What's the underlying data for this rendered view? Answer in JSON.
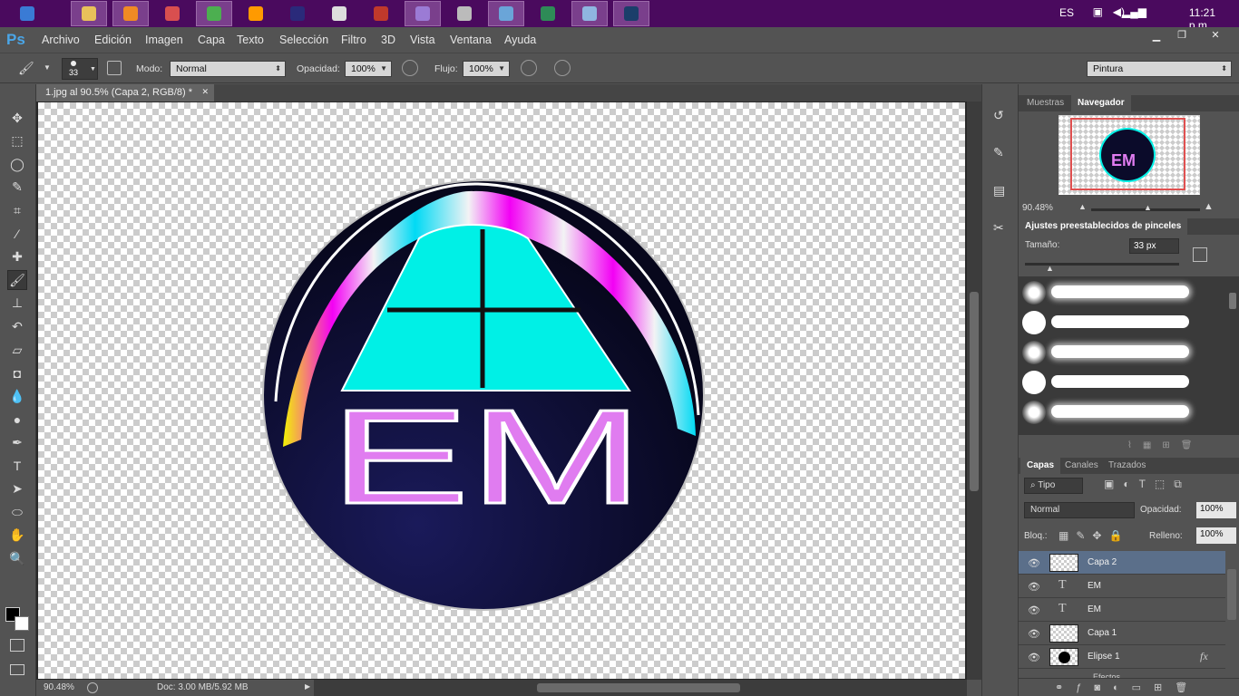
{
  "taskbar": {
    "apps": [
      {
        "icon": "start-windows-icon",
        "color": "#3a7bd5",
        "active": false
      },
      {
        "icon": "file-explorer-icon",
        "color": "#e8c15a",
        "active": true
      },
      {
        "icon": "media-player-icon",
        "color": "#f08a24",
        "active": true
      },
      {
        "icon": "paint-icon",
        "color": "#d94f4f",
        "active": false
      },
      {
        "icon": "chrome-icon",
        "color": "#4caf50",
        "active": true
      },
      {
        "icon": "illustrator-icon",
        "color": "#ff9a00",
        "active": false
      },
      {
        "icon": "premiere-icon",
        "color": "#2a2a7a",
        "active": false
      },
      {
        "icon": "figure-app-icon",
        "color": "#dddddd",
        "active": false
      },
      {
        "icon": "red-disc-icon",
        "color": "#c0392b",
        "active": false
      },
      {
        "icon": "palette-icon",
        "color": "#9b7bd5",
        "active": true
      },
      {
        "icon": "pen-app-icon",
        "color": "#bbbbbb",
        "active": false
      },
      {
        "icon": "keyboard-icon",
        "color": "#6aa5d8",
        "active": true
      },
      {
        "icon": "arrow-app-icon",
        "color": "#2e8b57",
        "active": false
      },
      {
        "icon": "notepad-icon",
        "color": "#8fb6e0",
        "active": true
      },
      {
        "icon": "photoshop-icon",
        "color": "#1b3e6a",
        "active": true
      }
    ],
    "tray": {
      "lang": "ES",
      "time": "11:21 p.m."
    }
  },
  "app": {
    "logo": "Ps"
  },
  "menu": [
    "Archivo",
    "Edición",
    "Imagen",
    "Capa",
    "Texto",
    "Selección",
    "Filtro",
    "3D",
    "Vista",
    "Ventana",
    "Ayuda"
  ],
  "options": {
    "brush_size": "33",
    "mode_label": "Modo:",
    "mode_value": "Normal",
    "opacity_label": "Opacidad:",
    "opacity_value": "100%",
    "flow_label": "Flujo:",
    "flow_value": "100%",
    "workspace": "Pintura"
  },
  "document": {
    "tab_title": "1.jpg al 90.5% (Capa 2, RGB/8) *",
    "logo_text": "EM",
    "colors": {
      "cyan": "#00f0e6",
      "violet": "#e07cf0",
      "navy": "#0b0b2a"
    }
  },
  "status": {
    "zoom": "90.48%",
    "doc": "Doc: 3.00 MB/5.92 MB"
  },
  "navigator": {
    "tabs": [
      "Muestras",
      "Navegador"
    ],
    "active_tab": "Navegador",
    "zoom": "90.48%",
    "thumb_text": "EM"
  },
  "brush_presets": {
    "title": "Ajustes preestablecidos de pinceles",
    "size_label": "Tamaño:",
    "size_value": "33 px"
  },
  "layers": {
    "tabs": [
      "Capas",
      "Canales",
      "Trazados"
    ],
    "active_tab": "Capas",
    "filter": "Tipo",
    "blend_mode": "Normal",
    "opacity_label": "Opacidad:",
    "opacity_value": "100%",
    "lock_label": "Bloq.:",
    "fill_label": "Relleno:",
    "fill_value": "100%",
    "items": [
      {
        "name": "Capa 2",
        "kind": "pixel",
        "selected": true
      },
      {
        "name": "EM",
        "kind": "text",
        "selected": false
      },
      {
        "name": "EM",
        "kind": "text",
        "selected": false
      },
      {
        "name": "Capa 1",
        "kind": "pixel",
        "selected": false
      },
      {
        "name": "Elipse 1",
        "kind": "shape",
        "selected": false,
        "fx": "fx"
      }
    ],
    "effects_label": "Efectos"
  }
}
